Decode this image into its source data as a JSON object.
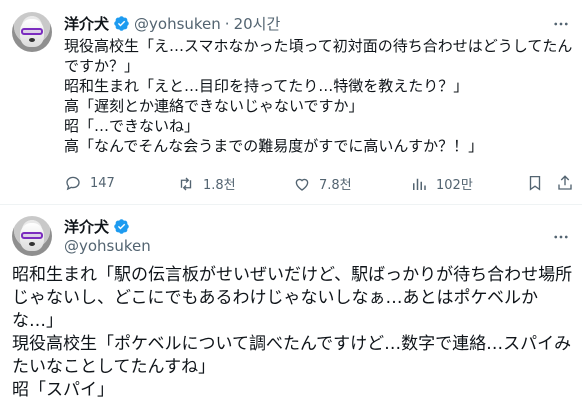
{
  "tweet1": {
    "display_name": "洋介犬",
    "handle": "@yohsuken",
    "separator": "·",
    "time": "20시간",
    "lines": [
      "現役高校生「え…スマホなかった頃って初対面の待ち合わせはどうしてたん",
      "ですか？」",
      "昭和生まれ「えと…目印を持ってたり…特徴を教えたり？」",
      "高「遅刻とか連絡できないじゃないですか」",
      "昭「…できないね」",
      "高「なんでそんな会うまでの難易度がすでに高いんすか？！」"
    ],
    "actions": {
      "reply_count": "147",
      "retweet_count": "1.8천",
      "like_count": "7.8천",
      "view_count": "102만"
    }
  },
  "tweet2": {
    "display_name": "洋介犬",
    "handle": "@yohsuken",
    "lines": [
      "昭和生まれ「駅の伝言板がせいぜいだけど、駅ばっかりが待ち合わせ場所",
      "じゃないし、どこにでもあるわけじゃないしなぁ…あとはポケベルか",
      "な…」",
      "現役高校生「ポケベルについて調べたんですけど…数字で連絡…スパイみ",
      "たいなことしてたんすね」",
      "昭「スパイ」"
    ]
  },
  "colors": {
    "text_primary": "#0f1419",
    "text_secondary": "#536471",
    "verified_blue": "#1d9bf0",
    "divider": "#eff3f4"
  }
}
